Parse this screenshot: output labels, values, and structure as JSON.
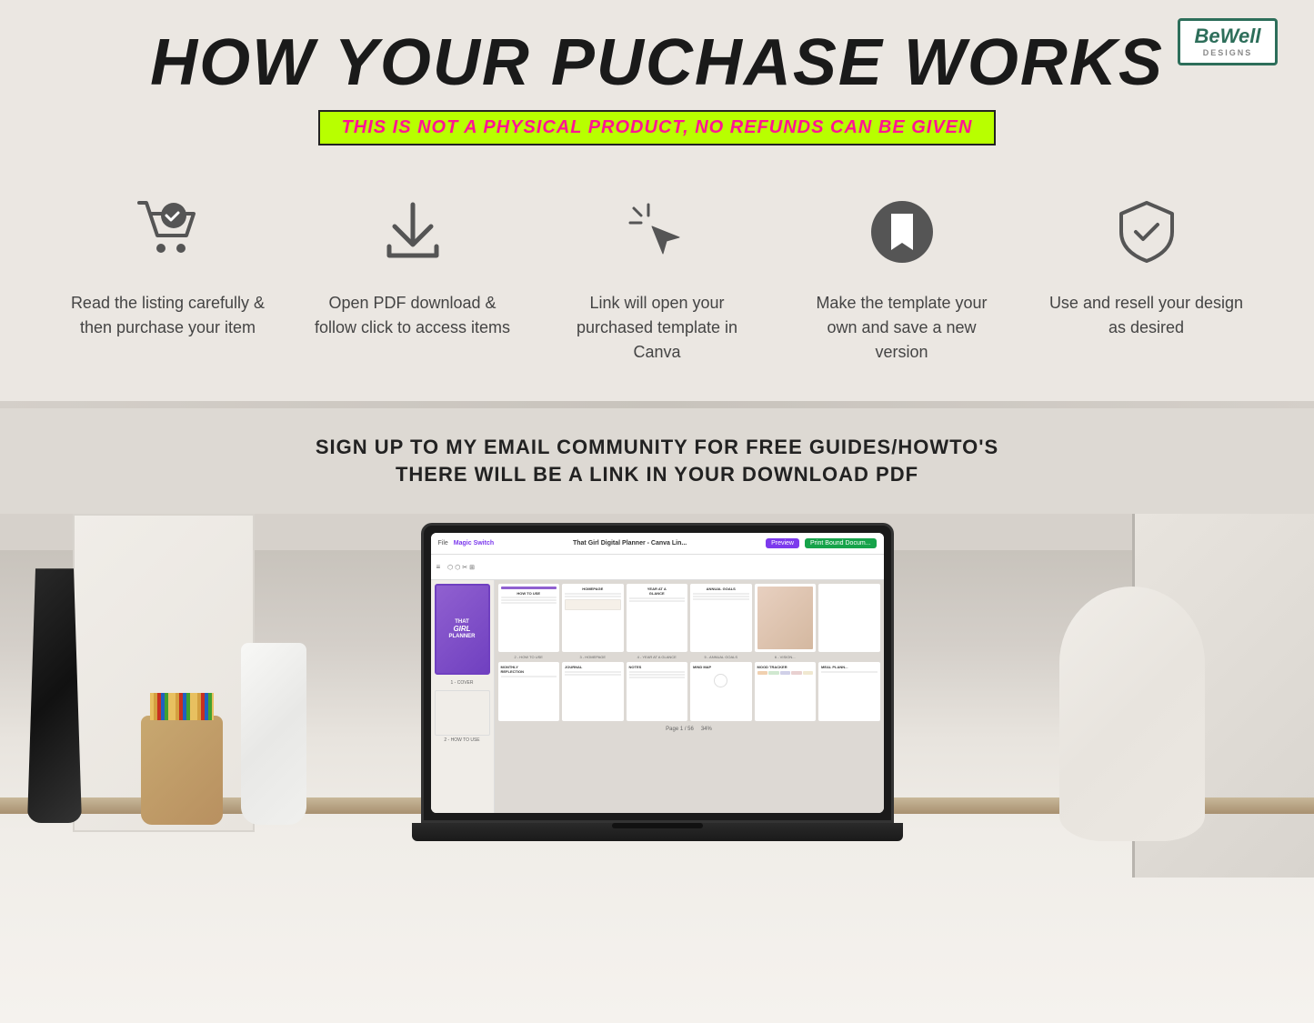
{
  "header": {
    "title": "HOW YOUR PUCHASE WORKS",
    "subtitle": "THIS IS NOT A PHYSICAL PRODUCT, NO REFUNDS CAN BE GIVEN"
  },
  "logo": {
    "line1": "BeWell",
    "line2": "DESIGNS"
  },
  "steps": [
    {
      "id": "step-1",
      "icon": "cart-check-icon",
      "text": "Read the listing carefully & then purchase your item"
    },
    {
      "id": "step-2",
      "icon": "download-icon",
      "text": "Open PDF download & follow click to access items"
    },
    {
      "id": "step-3",
      "icon": "cursor-icon",
      "text": "Link will open your purchased template in Canva"
    },
    {
      "id": "step-4",
      "icon": "bookmark-circle-icon",
      "text": "Make the template your own and save a new version"
    },
    {
      "id": "step-5",
      "icon": "shield-check-icon",
      "text": "Use and resell your design as desired"
    }
  ],
  "email_section": {
    "line1": "SIGN UP TO MY EMAIL COMMUNITY FOR FREE GUIDES/HOWTO'S",
    "line2": "THERE WILL BE A LINK IN YOUR DOWNLOAD PDF"
  },
  "canva": {
    "title": "That Girl Digital Planner - Canva Lin...",
    "preview_btn": "Preview",
    "print_btn": "Print Bound Docum...",
    "magic_switch": "Magic Switch",
    "page_count": "Page 1 / 56"
  }
}
